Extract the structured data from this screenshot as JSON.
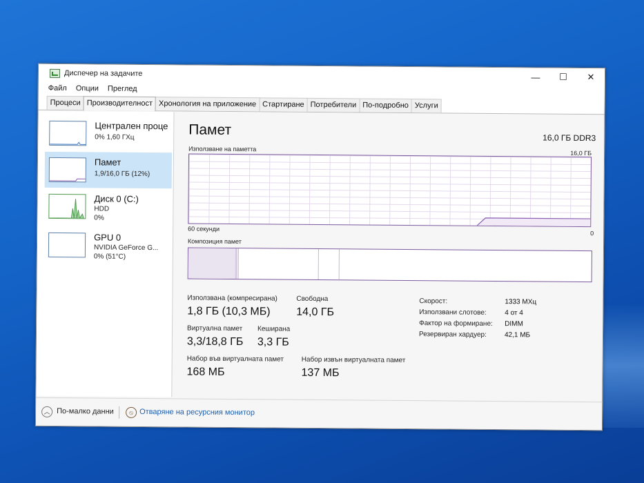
{
  "window": {
    "title": "Диспечер на задачите",
    "controls": {
      "minimize": "—",
      "maximize": "☐",
      "close": "✕"
    }
  },
  "menu": [
    "Файл",
    "Опции",
    "Преглед"
  ],
  "tabs": [
    "Процеси",
    "Производителност",
    "Хронология на приложение",
    "Стартиране",
    "Потребители",
    "По-подробно",
    "Услуги"
  ],
  "active_tab": "Производителност",
  "sidebar": {
    "items": [
      {
        "name": "Централен проце",
        "sub1": "0% 1,60 ГХц",
        "sub2": ""
      },
      {
        "name": "Памет",
        "sub1": "1,9/16,0 ГБ (12%)",
        "sub2": ""
      },
      {
        "name": "Диск 0 (C:)",
        "sub1": "HDD",
        "sub2": "0%"
      },
      {
        "name": "GPU 0",
        "sub1": "NVIDIA GeForce G...",
        "sub2": "0% (51°C)"
      }
    ]
  },
  "memory": {
    "title": "Памет",
    "capacity": "16,0 ГБ DDR3",
    "usage_label": "Използване на паметта",
    "graph_max": "16,0 ГБ",
    "graph_min": "0",
    "time_span": "60 секунди",
    "composition_label": "Композиция памет",
    "stats": {
      "in_use_label": "Използвана (компресирана)",
      "in_use_value": "1,8 ГБ (10,3 МБ)",
      "available_label": "Свободна",
      "available_value": "14,0 ГБ",
      "committed_label": "Виртуална памет",
      "committed_value": "3,3/18,8 ГБ",
      "cached_label": "Кеширана",
      "cached_value": "3,3 ГБ",
      "paged_pool_label": "Набор във виртуалната памет",
      "paged_pool_value": "168 МБ",
      "nonpaged_pool_label": "Набор извън виртуалната памет",
      "nonpaged_pool_value": "137 МБ"
    },
    "details": [
      {
        "key": "Скорост:",
        "value": "1333 МХц"
      },
      {
        "key": "Използвани слотове:",
        "value": "4 от 4"
      },
      {
        "key": "Фактор на формиране:",
        "value": "DIMM"
      },
      {
        "key": "Резервиран хардуер:",
        "value": "42,1 МБ"
      }
    ]
  },
  "footer": {
    "fewer_details": "По-малко данни",
    "resource_monitor": "Отваряне на ресурсния монитор"
  }
}
